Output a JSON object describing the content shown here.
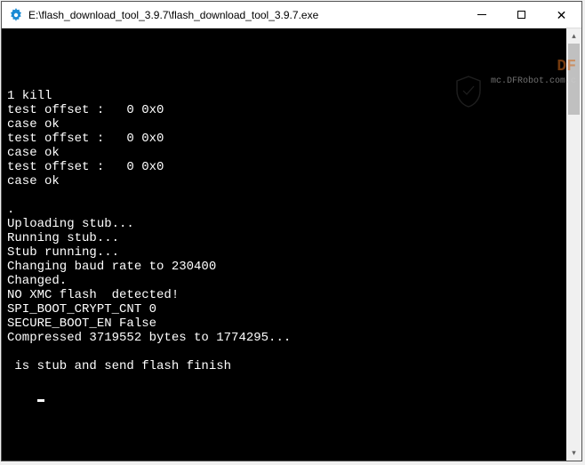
{
  "window": {
    "title": "E:\\flash_download_tool_3.9.7\\flash_download_tool_3.9.7.exe"
  },
  "watermark": {
    "brand": "DF",
    "url": "mc.DFRobot.com.c"
  },
  "console": {
    "lines": [
      "1 kill",
      "test offset :   0 0x0",
      "case ok",
      "test offset :   0 0x0",
      "case ok",
      "test offset :   0 0x0",
      "case ok",
      "",
      ".",
      "Uploading stub...",
      "Running stub...",
      "Stub running...",
      "Changing baud rate to 230400",
      "Changed.",
      "NO XMC flash  detected!",
      "SPI_BOOT_CRYPT_CNT 0",
      "SECURE_BOOT_EN False",
      "Compressed 3719552 bytes to 1774295...",
      "",
      " is stub and send flash finish"
    ]
  }
}
